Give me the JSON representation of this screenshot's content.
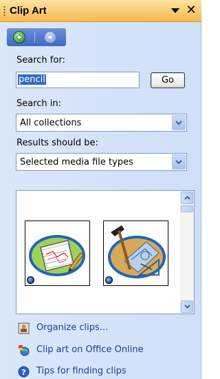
{
  "pane": {
    "title": "Clip Art",
    "close_glyph": "✕"
  },
  "search": {
    "label": "Search for:",
    "value": "pencil",
    "go_label": "Go"
  },
  "search_in": {
    "label": "Search in:",
    "selected": "All collections"
  },
  "results_type": {
    "label": "Results should be:",
    "selected": "Selected media file types"
  },
  "results": {
    "items": [
      {
        "icon": "pencil-drawing-clip"
      },
      {
        "icon": "drafting-tools-clip"
      }
    ]
  },
  "links": [
    {
      "label": "Organize clips...",
      "icon": "organizer-icon"
    },
    {
      "label": "Clip art on Office Online",
      "icon": "office-online-icon"
    },
    {
      "label": "Tips for finding clips",
      "icon": "help-icon"
    }
  ],
  "colors": {
    "title_bar": "#f8b94e",
    "pane_bg": "#dbe7fb",
    "link_text": "#213d8c"
  }
}
